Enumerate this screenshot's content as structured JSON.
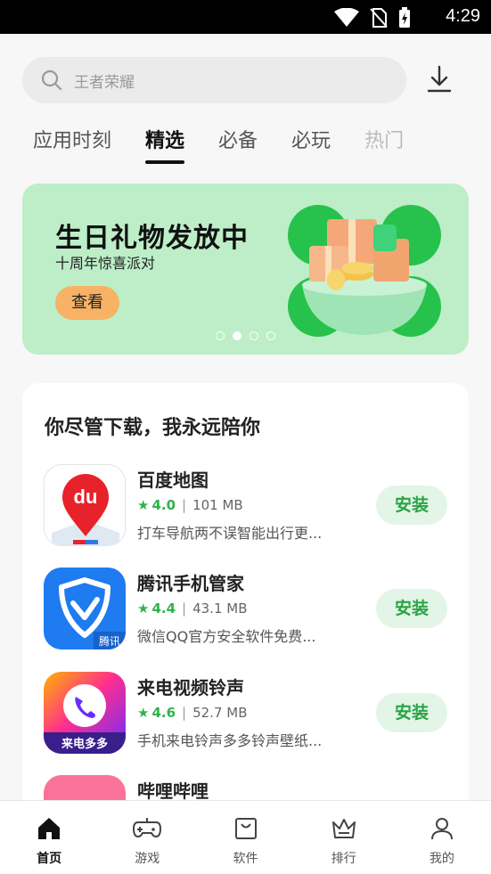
{
  "status_bar": {
    "time": "4:29"
  },
  "search": {
    "placeholder": "王者荣耀"
  },
  "tabs": [
    {
      "label": "应用时刻"
    },
    {
      "label": "精选"
    },
    {
      "label": "必备"
    },
    {
      "label": "必玩"
    },
    {
      "label": "热门"
    }
  ],
  "banner": {
    "title": "生日礼物发放中",
    "subtitle": "十周年惊喜派对",
    "button": "查看",
    "page_index": 2,
    "page_count": 4
  },
  "section": {
    "heading": "你尽管下载，我永远陪你",
    "apps": [
      {
        "name": "百度地图",
        "rating": "4.0",
        "size": "101 MB",
        "desc": "打车导航两不误智能出行更...",
        "action": "安装"
      },
      {
        "name": "腾讯手机管家",
        "rating": "4.4",
        "size": "43.1 MB",
        "desc": "微信QQ官方安全软件免费...",
        "action": "安装",
        "icon_text": "腾讯"
      },
      {
        "name": "来电视频铃声",
        "rating": "4.6",
        "size": "52.7 MB",
        "desc": "手机来电铃声多多铃声壁纸...",
        "action": "安装",
        "icon_text": "来电多多"
      },
      {
        "name": "哔哩哔哩"
      }
    ]
  },
  "nav": [
    {
      "label": "首页",
      "icon": "home-icon"
    },
    {
      "label": "游戏",
      "icon": "gamepad-icon"
    },
    {
      "label": "软件",
      "icon": "bag-icon"
    },
    {
      "label": "排行",
      "icon": "crown-icon"
    },
    {
      "label": "我的",
      "icon": "person-icon"
    }
  ],
  "colors": {
    "accent_green": "#2fb34a",
    "banner_bg": "#bdeec8",
    "banner_button": "#f7b265"
  }
}
